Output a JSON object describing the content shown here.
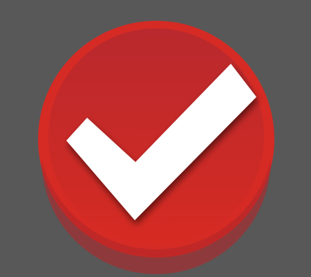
{
  "colors": {
    "background": "#585858",
    "circle_outer": "#d52b24",
    "circle_inner_top": "#b9292d",
    "circle_inner_bottom": "#d62a22",
    "checkmark": "#ffffff",
    "shadow": "#7a1414"
  },
  "icon": {
    "name": "checkmark-icon",
    "shape": "circle-badge-with-check"
  }
}
